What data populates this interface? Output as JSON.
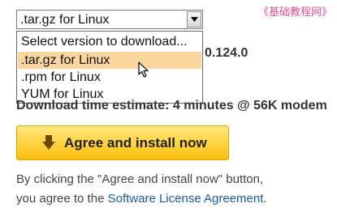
{
  "watermark": "《基础教程网》",
  "version_select": {
    "selected_value": ".tar.gz for Linux",
    "options": [
      "Select version to download...",
      ".tar.gz for Linux",
      ".rpm for Linux",
      "YUM for Linux"
    ],
    "highlighted_option": ".tar.gz for Linux"
  },
  "version_partial": "0.124.0",
  "download_estimate": "Download time estimate: 4 minutes @ 56K modem",
  "install_button": {
    "label": "Agree and install now",
    "icon": "down-arrow-icon"
  },
  "license": {
    "line1": "By clicking the \"Agree and install now\" button,",
    "line2_prefix": "you agree to the ",
    "link_text": "Software License Agreement",
    "line2_suffix": "."
  },
  "colors": {
    "button_gradient_top": "#ffe880",
    "button_gradient_bottom": "#fbbd0a",
    "option_highlight": "#fbd5a0",
    "link": "#1a5a9a",
    "watermark": "#e0508e"
  }
}
